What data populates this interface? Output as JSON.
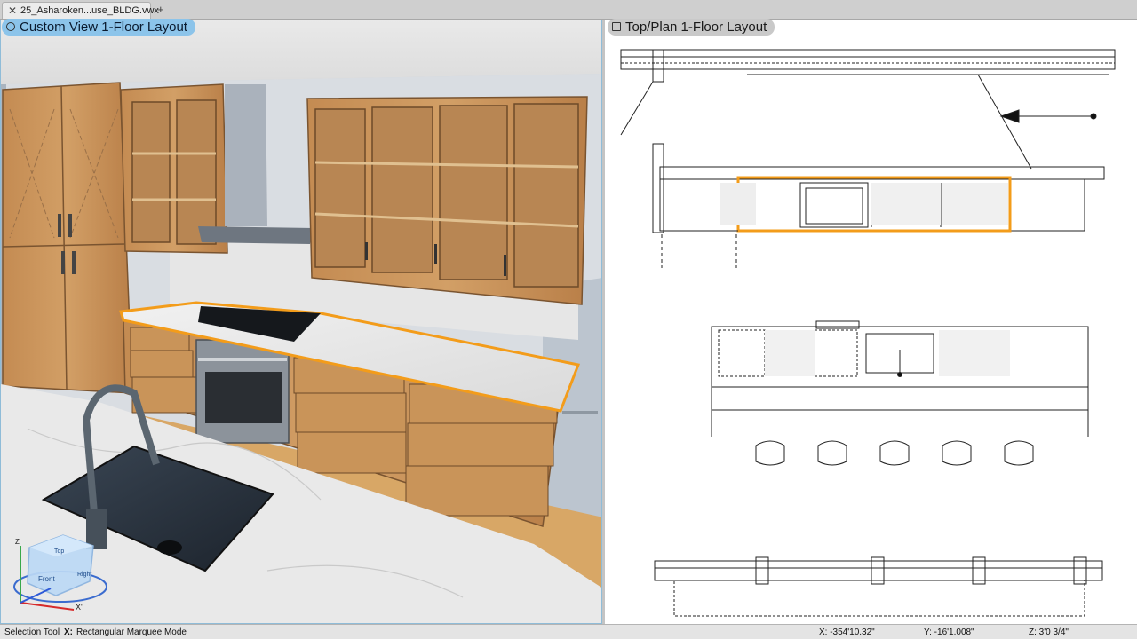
{
  "tabs": [
    {
      "label": "25_Asharoken...use_BLDG.vwx",
      "close": "✕"
    }
  ],
  "tab_add": "+",
  "viewports": {
    "left": {
      "label": "Custom View  1-Floor Layout"
    },
    "right": {
      "label": "Top/Plan  1-Floor Layout"
    }
  },
  "view_cube": {
    "top": "Top",
    "front": "Front",
    "right": "Right",
    "axis_x": "X'",
    "axis_z": "Z'"
  },
  "status": {
    "tool": "Selection Tool",
    "mode_key": "X:",
    "mode": "Rectangular Marquee Mode",
    "x": "X: -354'10.32\"",
    "y": "Y: -16'1.008\"",
    "z": "Z: 3'0 3/4\""
  },
  "colors": {
    "selection": "#f39c1a",
    "wood": "#c8935a",
    "viewport_label_active": "#8cc4ea",
    "viewport_label_inactive": "#c9c9c9"
  }
}
